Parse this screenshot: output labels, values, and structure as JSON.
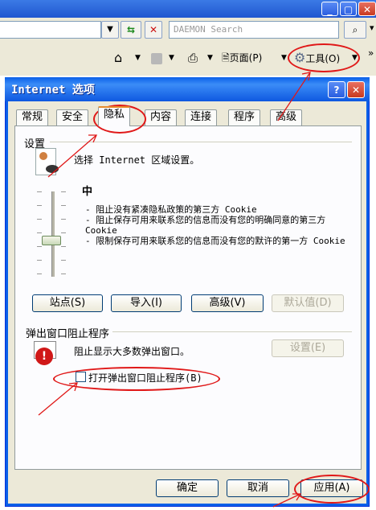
{
  "browser": {
    "window_controls": [
      "_",
      "▢",
      "✕"
    ],
    "search_placeholder": "DAEMON Search",
    "commandbar": {
      "page_label": "页面(P)",
      "tools_label": "工具(O)"
    }
  },
  "dialog": {
    "title": "Internet 选项",
    "tabs": [
      {
        "label": "常规"
      },
      {
        "label": "安全"
      },
      {
        "label": "隐私"
      },
      {
        "label": "内容"
      },
      {
        "label": "连接"
      },
      {
        "label": "程序"
      },
      {
        "label": "高级"
      }
    ],
    "active_tab": "隐私",
    "settings": {
      "group_label": "设置",
      "prompt": "选择 Internet 区域设置。",
      "level": "中",
      "level_fraction": 0.5,
      "bullets": [
        "- 阻止没有紧凑隐私政策的第三方 Cookie",
        "- 阻止保存可用来联系您的信息而没有您的明确同意的第三方 Cookie",
        "- 限制保存可用来联系您的信息而没有您的默许的第一方 Cookie"
      ],
      "buttons": {
        "sites": "站点(S)",
        "import": "导入(I)",
        "advanced": "高级(V)",
        "default": "默认值(D)"
      }
    },
    "popup": {
      "group_label": "弹出窗口阻止程序",
      "description": "阻止显示大多数弹出窗口。",
      "settings_button": "设置(E)",
      "checkbox_label": "打开弹出窗口阻止程序(B)",
      "checkbox_checked": false
    },
    "footer": {
      "ok": "确定",
      "cancel": "取消",
      "apply": "应用(A)"
    }
  },
  "colors": {
    "annotation": "#e01818",
    "dialog_title": "#0a5fe8",
    "dialog_body": "#ece9d8"
  }
}
